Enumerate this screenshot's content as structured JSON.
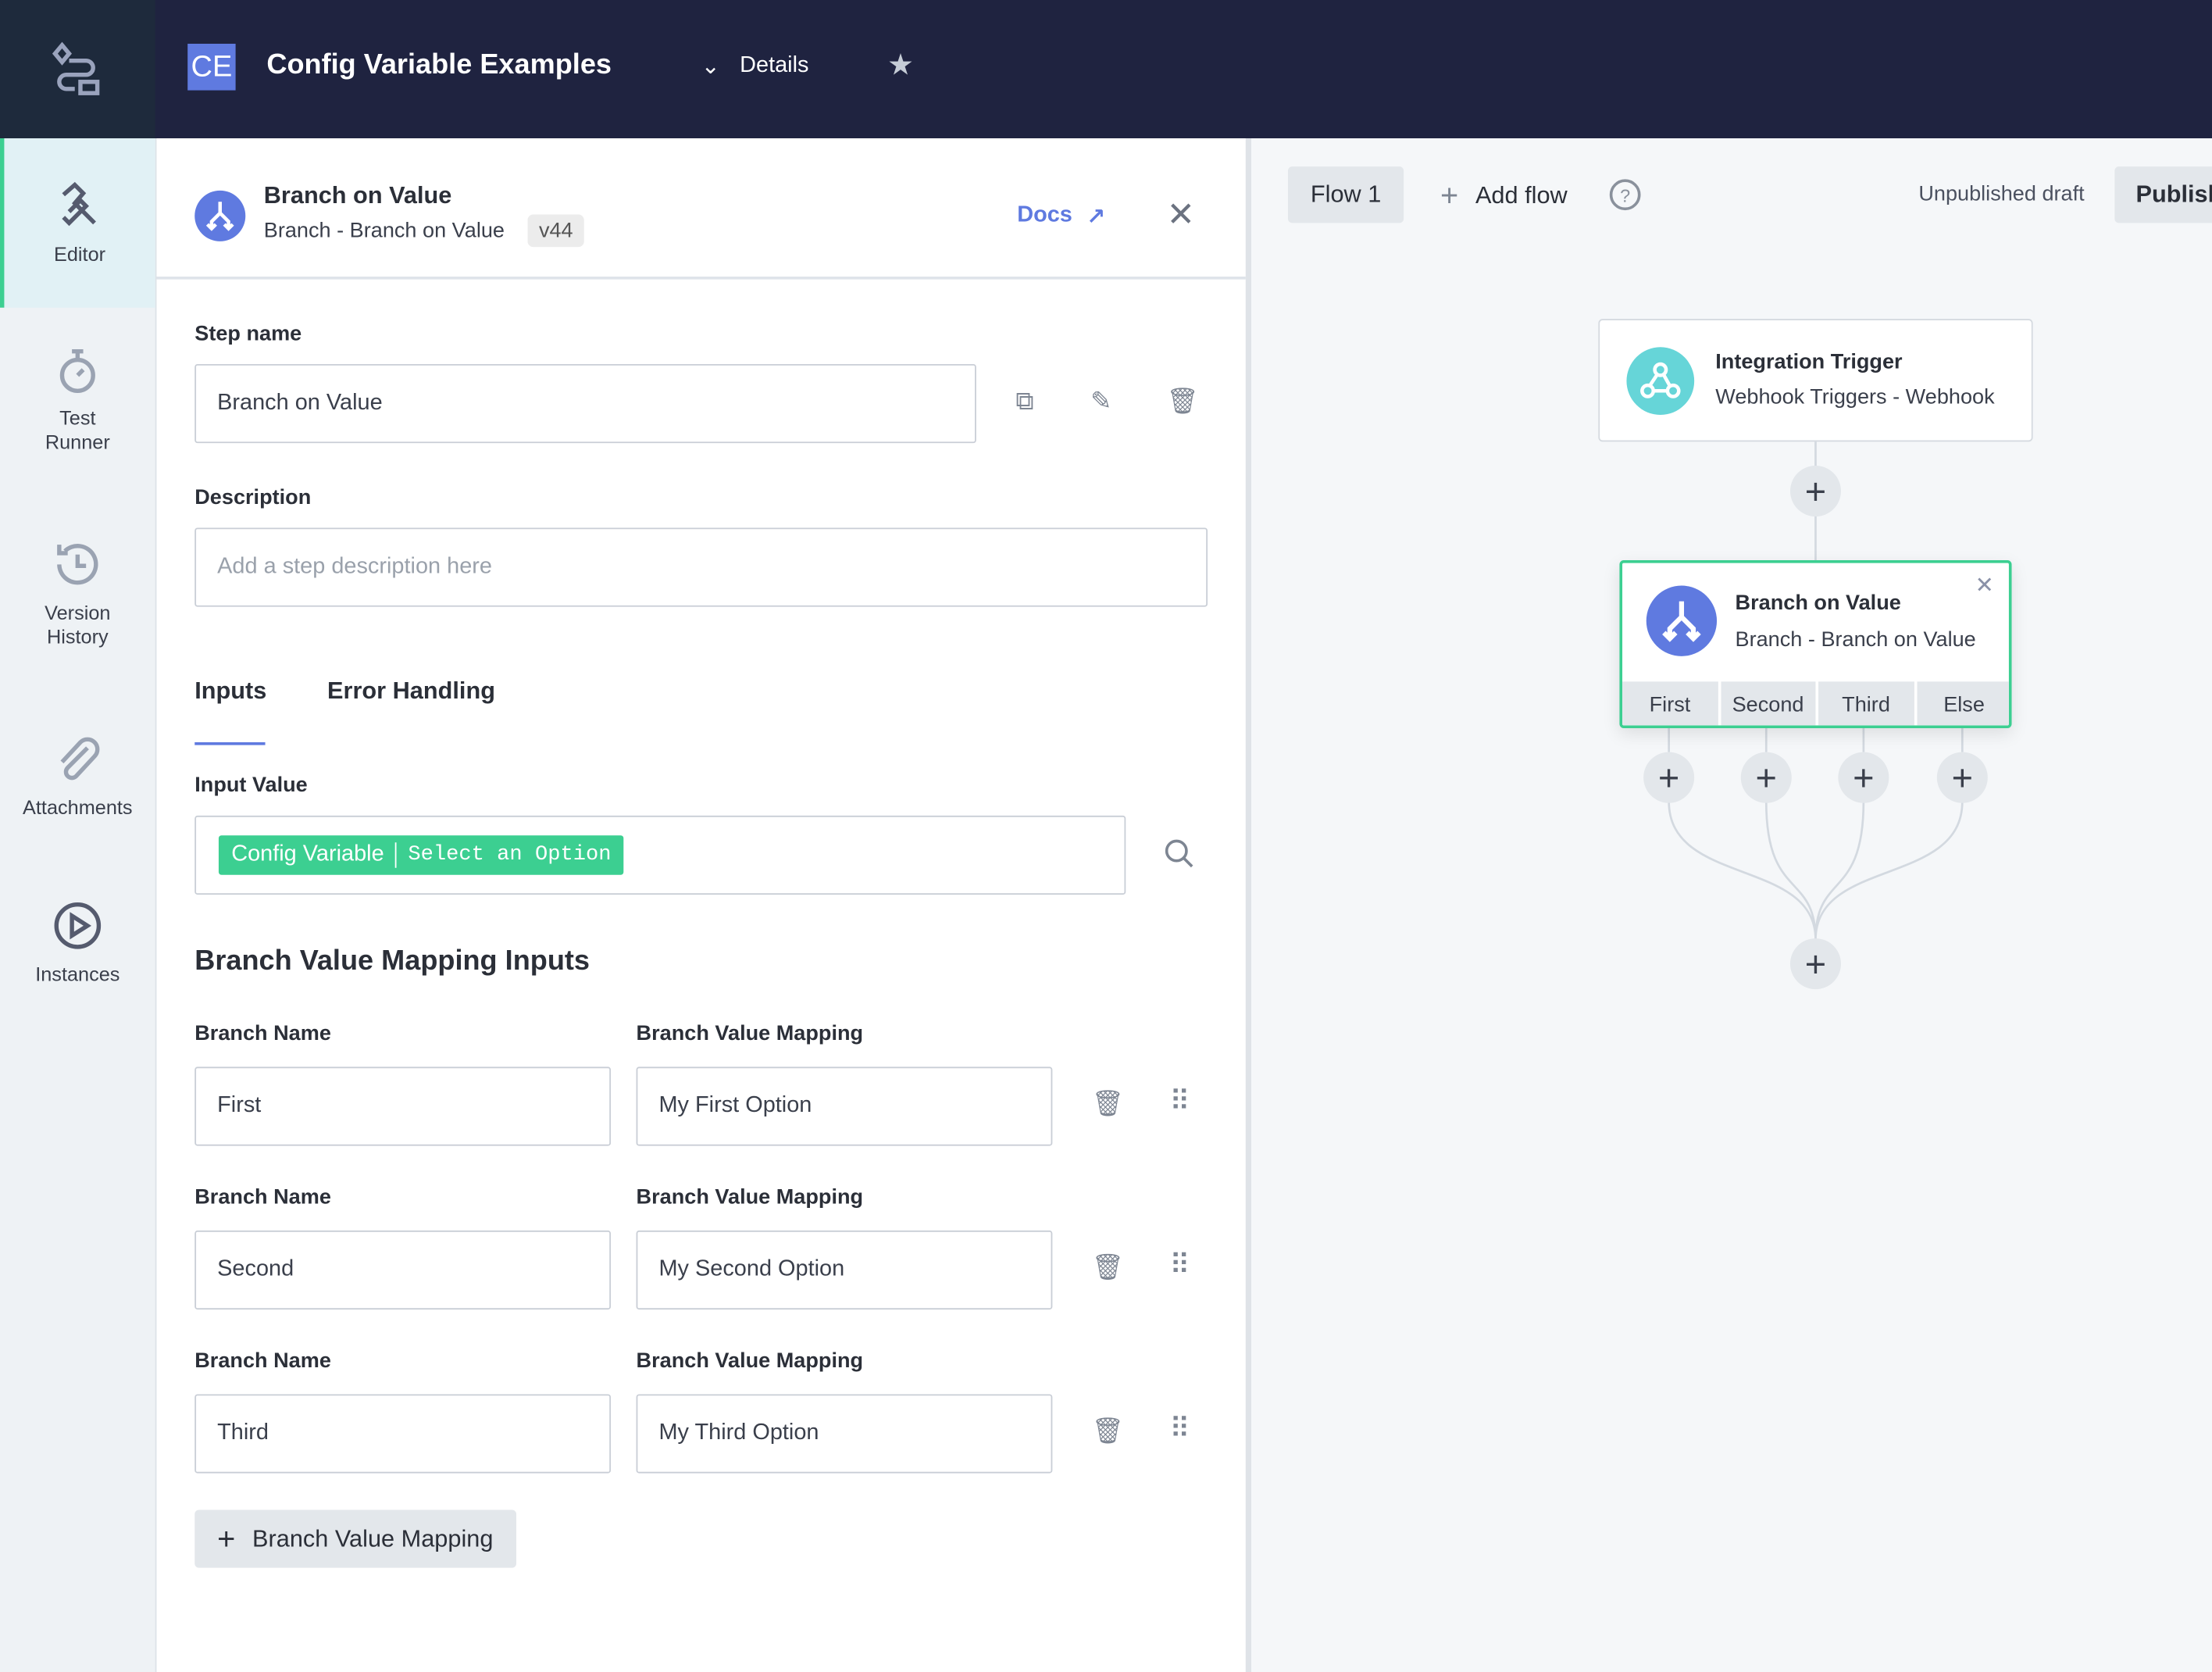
{
  "header": {
    "app_initials": "CE",
    "title": "Config Variable Examples",
    "details_label": "Details",
    "logo_icon": "flow-logo-icon",
    "favorite_icon": "star-icon"
  },
  "sidebar": {
    "items": [
      {
        "label": "Editor",
        "icon": "wrench-icon",
        "active": true
      },
      {
        "label": "Test\nRunner",
        "icon": "stopwatch-icon"
      },
      {
        "label": "Version\nHistory",
        "icon": "history-icon"
      },
      {
        "label": "Attachments",
        "icon": "paperclip-icon"
      },
      {
        "label": "Instances",
        "icon": "play-circle-icon"
      }
    ]
  },
  "panel": {
    "step_title": "Branch on Value",
    "step_subtitle": "Branch - Branch on Value",
    "version": "v44",
    "docs_label": "Docs",
    "step_name_label": "Step name",
    "step_name_value": "Branch on Value",
    "description_label": "Description",
    "description_placeholder": "Add a step description here",
    "tabs": [
      {
        "label": "Inputs",
        "active": true
      },
      {
        "label": "Error Handling"
      }
    ],
    "input_value_label": "Input Value",
    "config_chip_name": "Config Variable",
    "config_chip_value": "Select an Option",
    "mapping_heading": "Branch Value Mapping Inputs",
    "rows": [
      {
        "name_label": "Branch Name",
        "name": "First",
        "map_label": "Branch Value Mapping",
        "map": "My First Option"
      },
      {
        "name_label": "Branch Name",
        "name": "Second",
        "map_label": "Branch Value Mapping",
        "map": "My Second Option"
      },
      {
        "name_label": "Branch Name",
        "name": "Third",
        "map_label": "Branch Value Mapping",
        "map": "My Third Option"
      }
    ],
    "add_mapping_label": "Branch Value Mapping"
  },
  "canvas": {
    "flow_tab": "Flow 1",
    "add_flow": "Add flow",
    "status": "Unpublished draft",
    "publish": "Publish",
    "trigger": {
      "title": "Integration Trigger",
      "subtitle": "Webhook Triggers - Webhook"
    },
    "branch": {
      "title": "Branch on Value",
      "subtitle": "Branch - Branch on Value",
      "branches": [
        "First",
        "Second",
        "Third",
        "Else"
      ]
    }
  },
  "colors": {
    "accent": "#5f7ae0",
    "green": "#3ccf91",
    "teal": "#66d5d8",
    "topbar": "#1f2340"
  }
}
